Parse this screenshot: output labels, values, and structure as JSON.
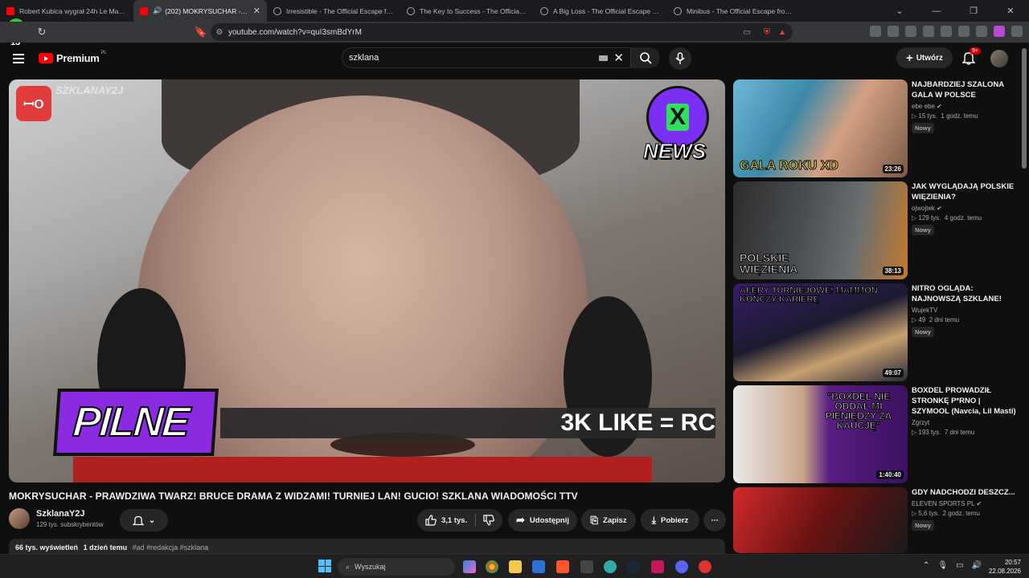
{
  "browser": {
    "tabs": [
      {
        "title": "Robert Kubica wygrał 24h Le Mans w",
        "icon": "youtube-icon",
        "active": false
      },
      {
        "title": "(202) MOKRYSUCHAR - PRAW",
        "icon": "youtube-icon",
        "active": true
      },
      {
        "title": "Irresistible - The Official Escape from",
        "icon": "github-icon",
        "active": false
      },
      {
        "title": "The Key to Success - The Official Esc",
        "icon": "github-icon",
        "active": false
      },
      {
        "title": "A Big Loss - The Official Escape from",
        "icon": "github-icon",
        "active": false
      },
      {
        "title": "Minibus - The Official Escape from Ta",
        "icon": "github-icon",
        "active": false
      }
    ],
    "url": "youtube.com/watch?v=quI3smBdYrM"
  },
  "youtube": {
    "logo_text": "Premium",
    "logo_region": "PL",
    "search_value": "szklana",
    "create_label": "Utwórz",
    "notification_count": "9+"
  },
  "player": {
    "watermark": "SZKLANAY2J",
    "news_badge": "NEWS",
    "pilne": "PILNE",
    "ticker": "3K LIKE = RC"
  },
  "video": {
    "title": "MOKRYSUCHAR - PRAWDZIWA TWARZ! BRUCE DRAMA Z WIDZAMI! TURNIEJ LAN! GUCIO! SZKLANA WIADOMOŚCI TTV",
    "channel": "SzklanaY2J",
    "subscribers": "129 tys. subskrybentów",
    "likes": "3,1 tys.",
    "share_label": "Udostępnij",
    "save_label": "Zapisz",
    "download_label": "Pobierz",
    "views": "66 tys. wyświetleń",
    "age": "1 dzień temu",
    "tags": "#ad #redakcja #szklana"
  },
  "recommendations": [
    {
      "title": "NAJBARDZIEJ SZALONA GALA W POLSCE",
      "channel": "ebe ebe",
      "views": "15 tys.",
      "age": "1 godz. temu",
      "badge": "Nowy",
      "duration": "23:26",
      "thumb_text": "GALA ROKU XD"
    },
    {
      "title": "JAK WYGLĄDAJĄ POLSKIE WIĘZIENIA?",
      "channel": "ojwojtek",
      "views": "129 tys.",
      "age": "4 godz. temu",
      "badge": "Nowy",
      "duration": "38:13",
      "thumb_text": "POLSKIE WIĘZIENIA"
    },
    {
      "title": "NITRO OGLĄDA: NAJNOWSZĄ SZKLANE!",
      "channel": "WujekTV",
      "views": "49",
      "age": "2 dni temu",
      "badge": "Nowy",
      "duration": "49:07",
      "thumb_text": "AFERY TURNIEJOWE! MAMMON KOŃCZY KARIERĘ"
    },
    {
      "title": "BOXDEL PROWADZIŁ STRONKĘ P*RNO | SZYMOOL (Navcia, Lil Masti)",
      "channel": "Zgrzyt",
      "views": "193 tys.",
      "age": "7 dni temu",
      "badge": "",
      "duration": "1:40:40",
      "thumb_text": "\"BOXDEL NIE ODDAŁ MI PIENIĘDZY ZA KAUCJĘ\""
    },
    {
      "title": "GDY NADCHODZI DESZCZ...",
      "channel": "ELEVEN SPORTS PL",
      "views": "5,6 tys.",
      "age": "2 godz. temu",
      "badge": "Nowy",
      "duration": "",
      "thumb_text": ""
    }
  ],
  "taskbar": {
    "search_placeholder": "Wyszukaj",
    "time": "20:57",
    "date": "22.08.2026"
  }
}
